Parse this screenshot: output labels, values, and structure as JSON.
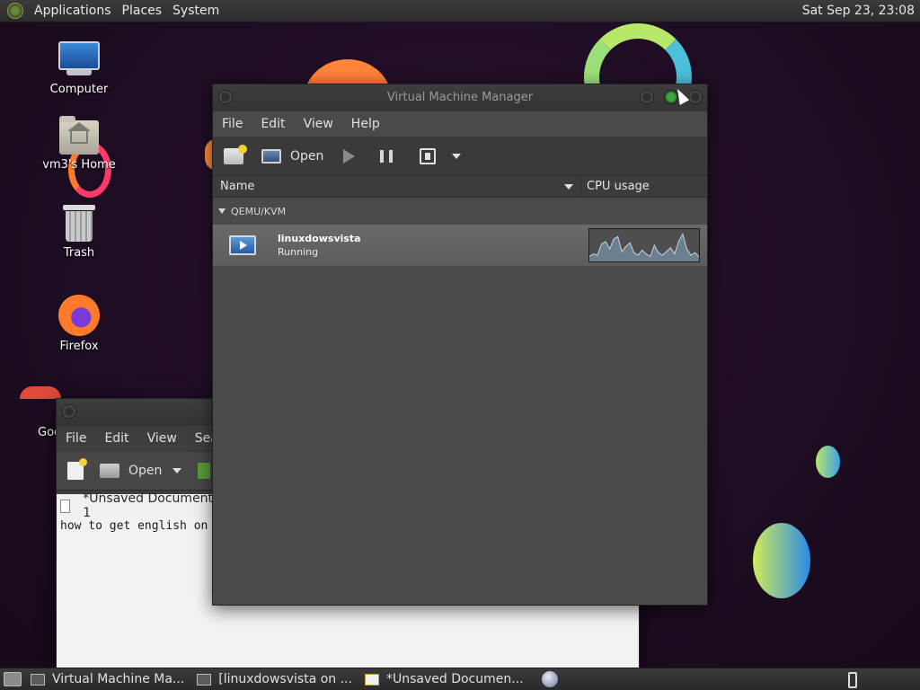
{
  "top_panel": {
    "menus": [
      "Applications",
      "Places",
      "System"
    ],
    "clock": "Sat Sep 23, 23:08"
  },
  "desktop": {
    "icons": [
      {
        "label": "Computer",
        "icon": "computer-icon"
      },
      {
        "label": "vm3's Home",
        "icon": "home-folder-icon"
      },
      {
        "label": "Trash",
        "icon": "trash-icon"
      },
      {
        "label": "Firefox",
        "icon": "firefox-icon"
      },
      {
        "label": "Goo",
        "icon": "chrome-icon"
      }
    ]
  },
  "vmm": {
    "title": "Virtual Machine Manager",
    "menu": [
      "File",
      "Edit",
      "View",
      "Help"
    ],
    "toolbar": {
      "open_label": "Open"
    },
    "columns": {
      "name": "Name",
      "cpu": "CPU usage"
    },
    "group": "QEMU/KVM",
    "vm": {
      "name": "linuxdowsvista",
      "status": "Running"
    },
    "cpu_series": [
      4,
      6,
      5,
      14,
      16,
      10,
      18,
      20,
      8,
      12,
      15,
      7,
      5,
      9,
      6,
      4,
      13,
      7,
      5,
      8,
      11,
      6,
      16,
      22,
      10,
      5,
      7,
      4
    ]
  },
  "editor": {
    "menu": [
      "File",
      "Edit",
      "View",
      "Searc"
    ],
    "toolbar": {
      "open_label": "Open"
    },
    "tab_label": "*Unsaved Document 1",
    "content": "how to get english on"
  },
  "taskbar": {
    "tasks": [
      "Virtual Machine Ma...",
      "[linuxdowsvista on ...",
      "*Unsaved Documen..."
    ]
  },
  "colors": {
    "panel_bg": "#2c2c2c",
    "window_bg": "#4a4a4a",
    "selected_row": "#646464"
  }
}
